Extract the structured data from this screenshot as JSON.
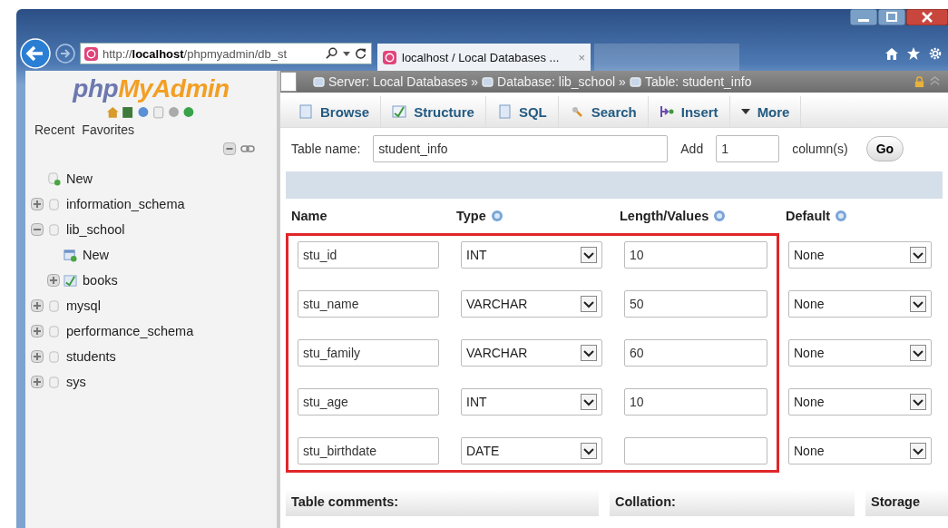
{
  "browser": {
    "address": "http://**localhost**/phpmyadmin/db_st",
    "tab_title": "localhost / Local Databases ...",
    "tab_close": "×"
  },
  "sidebar": {
    "logo_php": "php",
    "logo_myadmin": "MyAdmin",
    "links": [
      "Recent",
      "Favorites"
    ],
    "tree": [
      {
        "label": "New",
        "kind": "new"
      },
      {
        "label": "information_schema",
        "kind": "db",
        "expanded": false
      },
      {
        "label": "lib_school",
        "kind": "db",
        "expanded": true,
        "children": [
          {
            "label": "New",
            "kind": "new-table"
          },
          {
            "label": "books",
            "kind": "table",
            "expanded": false
          }
        ]
      },
      {
        "label": "mysql",
        "kind": "db",
        "expanded": false
      },
      {
        "label": "performance_schema",
        "kind": "db",
        "expanded": false
      },
      {
        "label": "students",
        "kind": "db",
        "expanded": false
      },
      {
        "label": "sys",
        "kind": "db",
        "expanded": false
      }
    ]
  },
  "breadcrumb": {
    "separator": "»",
    "items": [
      "Server: Local Databases",
      "Database: lib_school",
      "Table: student_info"
    ]
  },
  "tabs": [
    {
      "label": "Browse",
      "kind": "browse",
      "selected": false
    },
    {
      "label": "Structure",
      "kind": "structure",
      "selected": false
    },
    {
      "label": "SQL",
      "kind": "sql",
      "selected": false
    },
    {
      "label": "Search",
      "kind": "search",
      "selected": false
    },
    {
      "label": "Insert",
      "kind": "insert",
      "selected": false
    },
    {
      "label": "More",
      "kind": "more",
      "selected": false
    }
  ],
  "form": {
    "table_name_label": "Table name:",
    "table_name": "student_info",
    "add_label": "Add",
    "add_count": "1",
    "columns_label": "column(s)",
    "go": "Go"
  },
  "columns": {
    "headers": [
      "Name",
      "Type",
      "Length/Values",
      "Default"
    ],
    "highlighted": true,
    "rows": [
      {
        "name": "stu_id",
        "type": "INT",
        "length": "10",
        "default": "None"
      },
      {
        "name": "stu_name",
        "type": "VARCHAR",
        "length": "50",
        "default": "None"
      },
      {
        "name": "stu_family",
        "type": "VARCHAR",
        "length": "60",
        "default": "None"
      },
      {
        "name": "stu_age",
        "type": "INT",
        "length": "10",
        "default": "None"
      },
      {
        "name": "stu_birthdate",
        "type": "DATE",
        "length": "",
        "default": "None"
      }
    ]
  },
  "footer_headers": [
    "Table comments:",
    "Collation:",
    "Storage"
  ]
}
